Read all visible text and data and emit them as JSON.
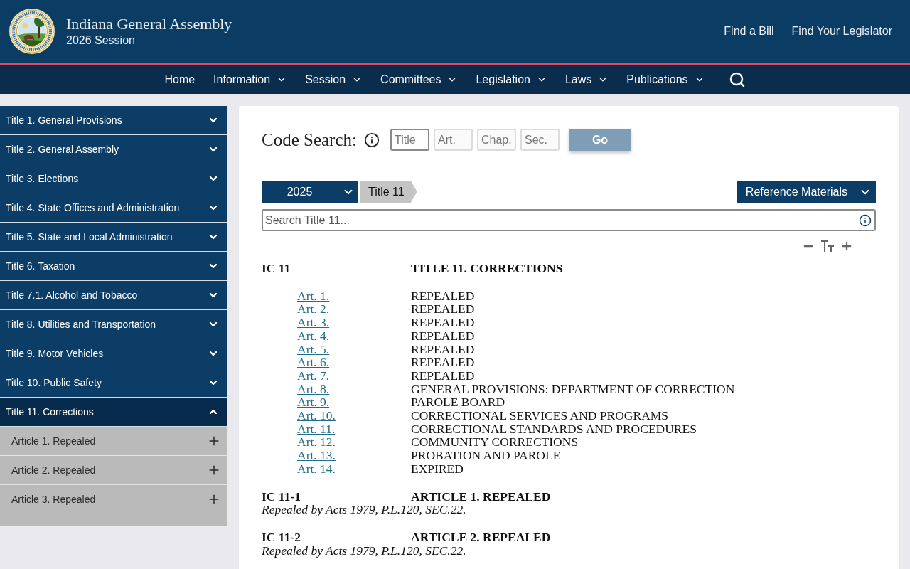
{
  "header": {
    "title": "Indiana General Assembly",
    "subtitle": "2026 Session",
    "links": [
      "Find a Bill",
      "Find Your Legislator"
    ]
  },
  "nav": {
    "items": [
      {
        "label": "Home",
        "has_menu": false
      },
      {
        "label": "Information",
        "has_menu": true
      },
      {
        "label": "Session",
        "has_menu": true
      },
      {
        "label": "Committees",
        "has_menu": true
      },
      {
        "label": "Legislation",
        "has_menu": true
      },
      {
        "label": "Laws",
        "has_menu": true
      },
      {
        "label": "Publications",
        "has_menu": true
      }
    ]
  },
  "sidebar": {
    "items": [
      {
        "label": "Title 1. General Provisions",
        "expanded": false
      },
      {
        "label": "Title 2. General Assembly",
        "expanded": false
      },
      {
        "label": "Title 3. Elections",
        "expanded": false
      },
      {
        "label": "Title 4. State Offices and Administration",
        "expanded": false
      },
      {
        "label": "Title 5. State and Local Administration",
        "expanded": false
      },
      {
        "label": "Title 6. Taxation",
        "expanded": false
      },
      {
        "label": "Title 7.1. Alcohol and Tobacco",
        "expanded": false
      },
      {
        "label": "Title 8. Utilities and Transportation",
        "expanded": false
      },
      {
        "label": "Title 9. Motor Vehicles",
        "expanded": false
      },
      {
        "label": "Title 10. Public Safety",
        "expanded": false
      },
      {
        "label": "Title 11. Corrections",
        "expanded": true,
        "children": [
          {
            "label": "Article 1. Repealed",
            "expanded": false
          },
          {
            "label": "Article 2. Repealed",
            "expanded": false
          },
          {
            "label": "Article 3. Repealed",
            "expanded": false
          }
        ]
      }
    ]
  },
  "code_search": {
    "label": "Code Search:",
    "fields": [
      {
        "placeholder": "Title",
        "focused": true
      },
      {
        "placeholder": "Art.",
        "focused": false
      },
      {
        "placeholder": "Chap.",
        "focused": false
      },
      {
        "placeholder": "Sec.",
        "focused": false
      }
    ],
    "go_button": {
      "label": "Go",
      "disabled": true
    }
  },
  "toolbar": {
    "year": "2025",
    "breadcrumbs": [
      "Title 11"
    ],
    "reference_menu": "Reference Materials"
  },
  "title_search": {
    "placeholder": "Search Title 11..."
  },
  "document": {
    "heading": {
      "cite": "IC 11",
      "title": "TITLE 11. CORRECTIONS"
    },
    "articles": [
      {
        "link": "Art. 1.",
        "title": "REPEALED"
      },
      {
        "link": "Art. 2.",
        "title": "REPEALED"
      },
      {
        "link": "Art. 3.",
        "title": "REPEALED"
      },
      {
        "link": "Art. 4.",
        "title": "REPEALED"
      },
      {
        "link": "Art. 5.",
        "title": "REPEALED"
      },
      {
        "link": "Art. 6.",
        "title": "REPEALED"
      },
      {
        "link": "Art. 7.",
        "title": "REPEALED"
      },
      {
        "link": "Art. 8.",
        "title": "GENERAL PROVISIONS: DEPARTMENT OF CORRECTION"
      },
      {
        "link": "Art. 9.",
        "title": "PAROLE BOARD"
      },
      {
        "link": "Art. 10.",
        "title": "CORRECTIONAL SERVICES AND PROGRAMS"
      },
      {
        "link": "Art. 11.",
        "title": "CORRECTIONAL STANDARDS AND PROCEDURES"
      },
      {
        "link": "Art. 12.",
        "title": "COMMUNITY CORRECTIONS"
      },
      {
        "link": "Art. 13.",
        "title": "PROBATION AND PAROLE"
      },
      {
        "link": "Art. 14.",
        "title": "EXPIRED"
      }
    ],
    "sections": [
      {
        "cite": "IC 11-1",
        "title": "ARTICLE 1. REPEALED",
        "note": "Repealed by Acts 1979, P.L.120, SEC.22."
      },
      {
        "cite": "IC 11-2",
        "title": "ARTICLE 2. REPEALED",
        "note": "Repealed by Acts 1979, P.L.120, SEC.22."
      }
    ]
  }
}
